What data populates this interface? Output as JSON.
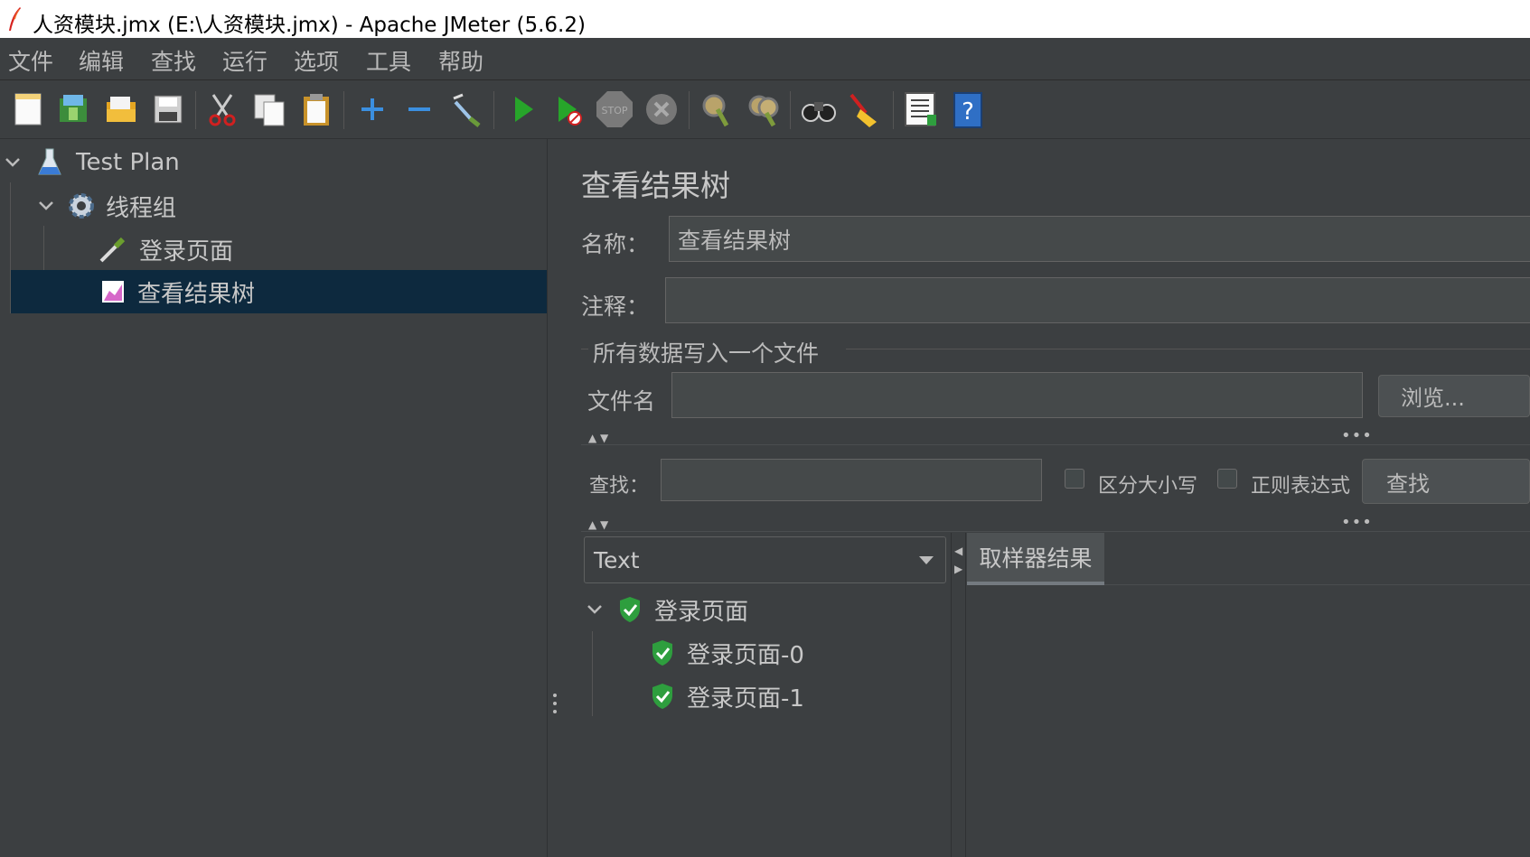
{
  "window": {
    "title": "人资模块.jmx (E:\\人资模块.jmx) - Apache JMeter (5.6.2)"
  },
  "menu": {
    "items": [
      "文件",
      "编辑",
      "查找",
      "运行",
      "选项",
      "工具",
      "帮助"
    ]
  },
  "toolbar": {
    "buttons": [
      "new-icon",
      "templates-icon",
      "open-icon",
      "save-icon",
      "cut-icon",
      "copy-icon",
      "paste-icon",
      "expand-icon",
      "collapse-icon",
      "toggle-icon",
      "start-icon",
      "start-no-pause-icon",
      "stop-icon",
      "shutdown-icon",
      "clear-icon",
      "clear-all-icon",
      "search-icon",
      "reset-search-icon",
      "function-helper-icon",
      "help-icon"
    ]
  },
  "tree": {
    "test_plan": "Test Plan",
    "thread_group": "线程组",
    "sampler": "登录页面",
    "listener": "查看结果树"
  },
  "panel": {
    "heading": "查看结果树",
    "name_label": "名称：",
    "name_value": "查看结果树",
    "comment_label": "注释：",
    "comment_value": "",
    "file_section_title": "所有数据写入一个文件",
    "filename_label": "文件名",
    "filename_value": "",
    "browse_label": "浏览...",
    "search_label": "查找：",
    "search_value": "",
    "case_sensitive_label": "区分大小写",
    "regex_label": "正则表达式",
    "find_button": "查找"
  },
  "results": {
    "renderer": "Text",
    "tab_label": "取样器结果",
    "tree": [
      {
        "label": "登录页面",
        "status": "success",
        "level": 0
      },
      {
        "label": "登录页面-0",
        "status": "success",
        "level": 1
      },
      {
        "label": "登录页面-1",
        "status": "success",
        "level": 1
      }
    ]
  },
  "colors": {
    "background": "#3c3f41",
    "selection": "#0d293e",
    "success": "#2e9e3e"
  }
}
